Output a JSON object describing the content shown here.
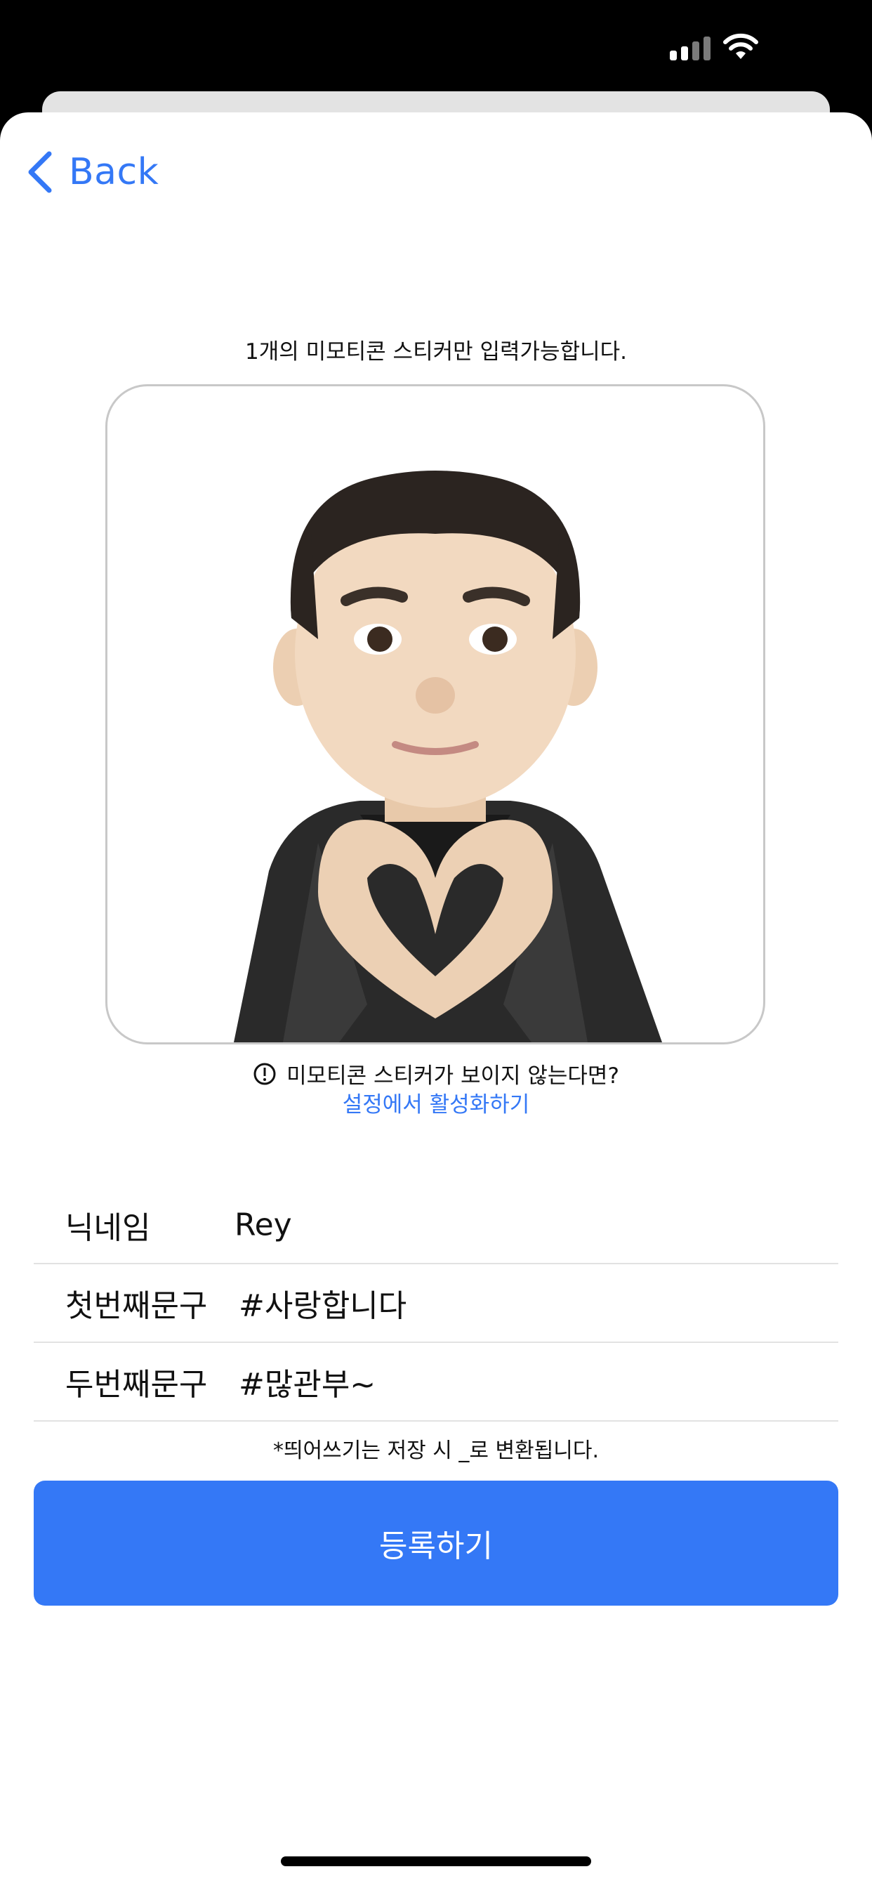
{
  "status_bar": {
    "signal_icon": "cellular-signal-icon",
    "wifi_icon": "wifi-icon"
  },
  "nav": {
    "back_label": "Back",
    "back_icon": "chevron-left-icon"
  },
  "instruction": "1개의 미모티콘 스티커만 입력가능합니다.",
  "sticker": {
    "icon": "memoji-heart-hands-sticker"
  },
  "notice": {
    "text": "미모티콘 스티커가 보이지 않는다면?",
    "icon": "info-circle-icon",
    "link": "설정에서 활성화하기"
  },
  "form": {
    "nickname_label": "닉네임",
    "nickname_value": "Rey",
    "first_phrase_label": "첫번째문구",
    "first_phrase_value": "#사랑합니다",
    "second_phrase_label": "두번째문구",
    "second_phrase_value": "#많관부~"
  },
  "hint": "*띄어쓰기는 저장 시 _로 변환됩니다.",
  "submit_label": "등록하기",
  "colors": {
    "accent": "#3478f6",
    "status_bar": "#000000",
    "sheet": "#ffffff"
  }
}
